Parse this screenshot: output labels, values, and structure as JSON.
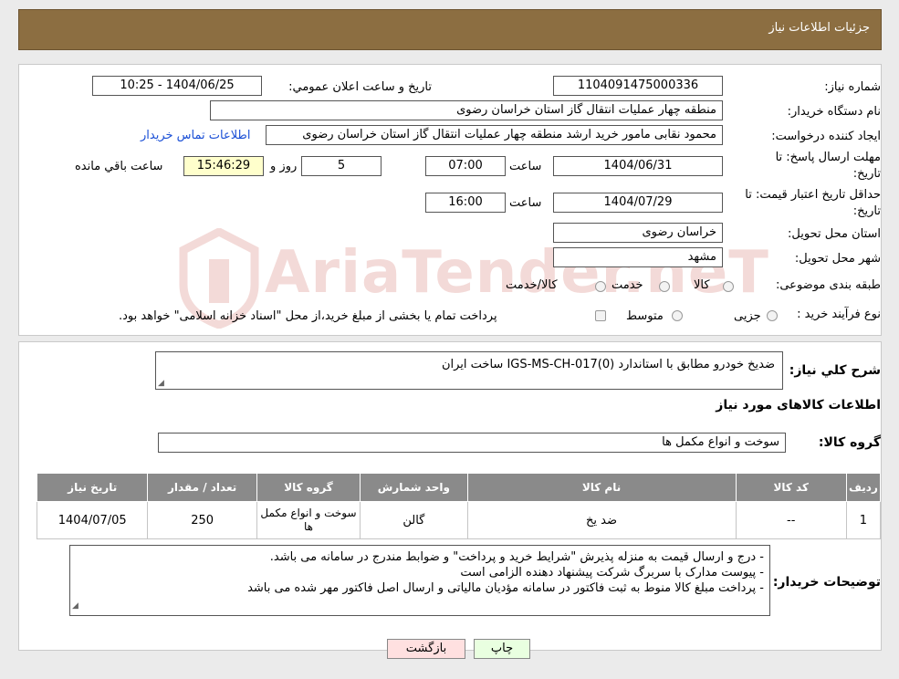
{
  "header": {
    "title": "جزئیات اطلاعات نیاز"
  },
  "form": {
    "need_number": {
      "label": "شماره نیاز:",
      "value": "1104091475000336"
    },
    "announce": {
      "label": "تاریخ و ساعت اعلان عمومي:",
      "value": "1404/06/25 - 10:25"
    },
    "buyer": {
      "label": "نام دستگاه خریدار:",
      "value": "منطقه چهار عملیات انتقال گاز   استان خراسان رضوی"
    },
    "requester": {
      "label": "ایجاد کننده درخواست:",
      "value": "محمود نقابی مامور خرید ارشد منطقه چهار عملیات انتقال گاز   استان خراسان رضوی",
      "contact_link": "اطلاعات تماس خریدار"
    },
    "deadline": {
      "label_line1": "مهلت ارسال پاسخ: تا",
      "label_line2": "تاریخ:",
      "date": "1404/06/31",
      "time_label": "ساعت",
      "time": "07:00",
      "days": "5",
      "days_label": "روز و",
      "remaining": "15:46:29",
      "remaining_label": "ساعت باقي مانده"
    },
    "validity": {
      "label_line1": "حداقل تاریخ اعتبار قیمت: تا",
      "label_line2": "تاریخ:",
      "date": "1404/07/29",
      "time_label": "ساعت",
      "time": "16:00"
    },
    "province": {
      "label": "استان محل تحویل:",
      "value": "خراسان رضوی"
    },
    "city": {
      "label": "شهر محل تحویل:",
      "value": "مشهد"
    },
    "category": {
      "label": "طبقه بندی موضوعی:",
      "options": [
        "کالا",
        "خدمت",
        "کالا/خدمت"
      ]
    },
    "process": {
      "label": "نوع فرآیند خرید :",
      "options": [
        "جزیی",
        "متوسط"
      ],
      "note": "پرداخت تمام یا بخشی از مبلغ خرید،از محل \"اسناد خزانه اسلامی\" خواهد بود."
    }
  },
  "description": {
    "label": "شرح کلي نیاز:",
    "value": "ضدیخ خودرو مطابق با استاندارد IGS-MS-CH-017(0) ساخت ایران"
  },
  "goods_section": {
    "title": "اطلاعات کالاهای مورد نیاز",
    "group_label": "گروه کالا:",
    "group_value": "سوخت و انواع مکمل ها"
  },
  "table": {
    "headers": [
      "ردیف",
      "کد کالا",
      "نام کالا",
      "واحد شمارش",
      "گروه کالا",
      "تعداد / مقدار",
      "تاریخ نیاز"
    ],
    "rows": [
      [
        "1",
        "--",
        "ضد یخ",
        "گالن",
        "سوخت و انواع مکمل ها",
        "250",
        "1404/07/05"
      ]
    ]
  },
  "buyer_notes": {
    "label": "توضیحات خریدار:",
    "lines": [
      "- درج و ارسال قیمت به منزله پذیرش \"شرایط خرید و پرداخت\" و ضوابط مندرج در سامانه می باشد.",
      "- پیوست مدارک با سربرگ شرکت پیشنهاد دهنده الزامی است",
      "- پرداخت مبلغ کالا منوط به ثبت فاکتور در سامانه مؤدیان مالیاتی و ارسال اصل فاکتور مهر شده  می باشد"
    ]
  },
  "buttons": {
    "print": "چاپ",
    "back": "بازگشت"
  },
  "watermark": {
    "text": "AriaTender.neT"
  },
  "colors": {
    "header": "#8c6e41",
    "table_header": "#8a8a8a",
    "print_button": "#e9ffe0",
    "back_button": "#ffe0e0",
    "link": "#1a4fd6"
  }
}
